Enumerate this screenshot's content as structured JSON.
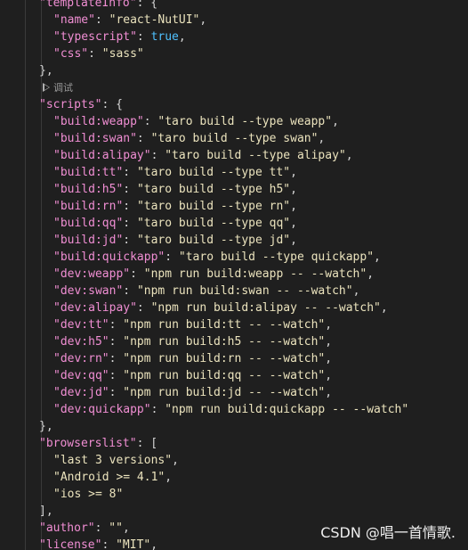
{
  "editor": {
    "codelens_label": "调试",
    "line_numbers": [
      "",
      "",
      "",
      "",
      "",
      "",
      "",
      "",
      "",
      "",
      "",
      "",
      "",
      "",
      "",
      "",
      "",
      "",
      "",
      "",
      "",
      "",
      "",
      "",
      "",
      "",
      "",
      "",
      "",
      "",
      "",
      "",
      ""
    ],
    "lines": [
      [
        [
          "k",
          "\"templateInfo\""
        ],
        [
          "p",
          ": {"
        ]
      ],
      [
        [
          "k",
          "\"name\""
        ],
        [
          "p",
          ": "
        ],
        [
          "s",
          "\"react-NutUI\""
        ],
        [
          "p",
          ","
        ]
      ],
      [
        [
          "k",
          "\"typescript\""
        ],
        [
          "p",
          ": "
        ],
        [
          "b",
          "true"
        ],
        [
          "p",
          ","
        ]
      ],
      [
        [
          "k",
          "\"css\""
        ],
        [
          "p",
          ": "
        ],
        [
          "s",
          "\"sass\""
        ]
      ],
      [
        [
          "p",
          "},"
        ]
      ],
      [
        [
          "k",
          "\"scripts\""
        ],
        [
          "p",
          ": {"
        ]
      ],
      [
        [
          "k",
          "\"build:weapp\""
        ],
        [
          "p",
          ": "
        ],
        [
          "s",
          "\"taro build --type weapp\""
        ],
        [
          "p",
          ","
        ]
      ],
      [
        [
          "k",
          "\"build:swan\""
        ],
        [
          "p",
          ": "
        ],
        [
          "s",
          "\"taro build --type swan\""
        ],
        [
          "p",
          ","
        ]
      ],
      [
        [
          "k",
          "\"build:alipay\""
        ],
        [
          "p",
          ": "
        ],
        [
          "s",
          "\"taro build --type alipay\""
        ],
        [
          "p",
          ","
        ]
      ],
      [
        [
          "k",
          "\"build:tt\""
        ],
        [
          "p",
          ": "
        ],
        [
          "s",
          "\"taro build --type tt\""
        ],
        [
          "p",
          ","
        ]
      ],
      [
        [
          "k",
          "\"build:h5\""
        ],
        [
          "p",
          ": "
        ],
        [
          "s",
          "\"taro build --type h5\""
        ],
        [
          "p",
          ","
        ]
      ],
      [
        [
          "k",
          "\"build:rn\""
        ],
        [
          "p",
          ": "
        ],
        [
          "s",
          "\"taro build --type rn\""
        ],
        [
          "p",
          ","
        ]
      ],
      [
        [
          "k",
          "\"build:qq\""
        ],
        [
          "p",
          ": "
        ],
        [
          "s",
          "\"taro build --type qq\""
        ],
        [
          "p",
          ","
        ]
      ],
      [
        [
          "k",
          "\"build:jd\""
        ],
        [
          "p",
          ": "
        ],
        [
          "s",
          "\"taro build --type jd\""
        ],
        [
          "p",
          ","
        ]
      ],
      [
        [
          "k",
          "\"build:quickapp\""
        ],
        [
          "p",
          ": "
        ],
        [
          "s",
          "\"taro build --type quickapp\""
        ],
        [
          "p",
          ","
        ]
      ],
      [
        [
          "k",
          "\"dev:weapp\""
        ],
        [
          "p",
          ": "
        ],
        [
          "s",
          "\"npm run build:weapp -- --watch\""
        ],
        [
          "p",
          ","
        ]
      ],
      [
        [
          "k",
          "\"dev:swan\""
        ],
        [
          "p",
          ": "
        ],
        [
          "s",
          "\"npm run build:swan -- --watch\""
        ],
        [
          "p",
          ","
        ]
      ],
      [
        [
          "k",
          "\"dev:alipay\""
        ],
        [
          "p",
          ": "
        ],
        [
          "s",
          "\"npm run build:alipay -- --watch\""
        ],
        [
          "p",
          ","
        ]
      ],
      [
        [
          "k",
          "\"dev:tt\""
        ],
        [
          "p",
          ": "
        ],
        [
          "s",
          "\"npm run build:tt -- --watch\""
        ],
        [
          "p",
          ","
        ]
      ],
      [
        [
          "k",
          "\"dev:h5\""
        ],
        [
          "p",
          ": "
        ],
        [
          "s",
          "\"npm run build:h5 -- --watch\""
        ],
        [
          "p",
          ","
        ]
      ],
      [
        [
          "k",
          "\"dev:rn\""
        ],
        [
          "p",
          ": "
        ],
        [
          "s",
          "\"npm run build:rn -- --watch\""
        ],
        [
          "p",
          ","
        ]
      ],
      [
        [
          "k",
          "\"dev:qq\""
        ],
        [
          "p",
          ": "
        ],
        [
          "s",
          "\"npm run build:qq -- --watch\""
        ],
        [
          "p",
          ","
        ]
      ],
      [
        [
          "k",
          "\"dev:jd\""
        ],
        [
          "p",
          ": "
        ],
        [
          "s",
          "\"npm run build:jd -- --watch\""
        ],
        [
          "p",
          ","
        ]
      ],
      [
        [
          "k",
          "\"dev:quickapp\""
        ],
        [
          "p",
          ": "
        ],
        [
          "s",
          "\"npm run build:quickapp -- --watch\""
        ]
      ],
      [
        [
          "p",
          "},"
        ]
      ],
      [
        [
          "k",
          "\"browserslist\""
        ],
        [
          "p",
          ": ["
        ]
      ],
      [
        [
          "s",
          "\"last 3 versions\""
        ],
        [
          "p",
          ","
        ]
      ],
      [
        [
          "s",
          "\"Android >= 4.1\""
        ],
        [
          "p",
          ","
        ]
      ],
      [
        [
          "s",
          "\"ios >= 8\""
        ]
      ],
      [
        [
          "p",
          "],"
        ]
      ],
      [
        [
          "k",
          "\"author\""
        ],
        [
          "p",
          ": "
        ],
        [
          "s",
          "\"\""
        ],
        [
          "p",
          ","
        ]
      ],
      [
        [
          "k",
          "\"license\""
        ],
        [
          "p",
          ": "
        ],
        [
          "s",
          "\"MIT\""
        ],
        [
          "p",
          ","
        ]
      ]
    ]
  },
  "watermark": {
    "text": "CSDN @唱一首情歌."
  }
}
